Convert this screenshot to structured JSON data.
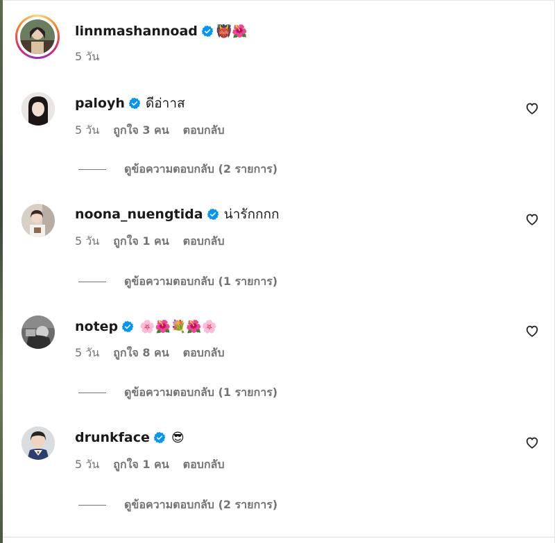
{
  "post": {
    "author": "linnmashannoad",
    "text": "👹🌺",
    "time": "5 วัน"
  },
  "comments": [
    {
      "username": "paloyh",
      "text": "ดีอ่าาส",
      "time": "5 วัน",
      "likes": "ถูกใจ 3 คน",
      "reply_label": "ตอบกลับ",
      "view_replies": "ดูข้อความตอบกลับ (2 รายการ)"
    },
    {
      "username": "noona_nuengtida",
      "text": "น่ารักกกก",
      "time": "5 วัน",
      "likes": "ถูกใจ 1 คน",
      "reply_label": "ตอบกลับ",
      "view_replies": "ดูข้อความตอบกลับ (1 รายการ)"
    },
    {
      "username": "notep",
      "text": "🌸🌺💐🌺🌸",
      "time": "5 วัน",
      "likes": "ถูกใจ 8 คน",
      "reply_label": "ตอบกลับ",
      "view_replies": "ดูข้อความตอบกลับ (1 รายการ)"
    },
    {
      "username": "drunkface",
      "text": "😎",
      "time": "5 วัน",
      "likes": "ถูกใจ 1 คน",
      "reply_label": "ตอบกลับ",
      "view_replies": "ดูข้อความตอบกลับ (2 รายการ)"
    }
  ],
  "colors": {
    "verified": "#0095f6",
    "secondary_text": "#737373",
    "primary_text": "#1a1a1a"
  },
  "icons": {
    "verified": "verified-badge-icon",
    "like": "heart-outline-icon"
  }
}
